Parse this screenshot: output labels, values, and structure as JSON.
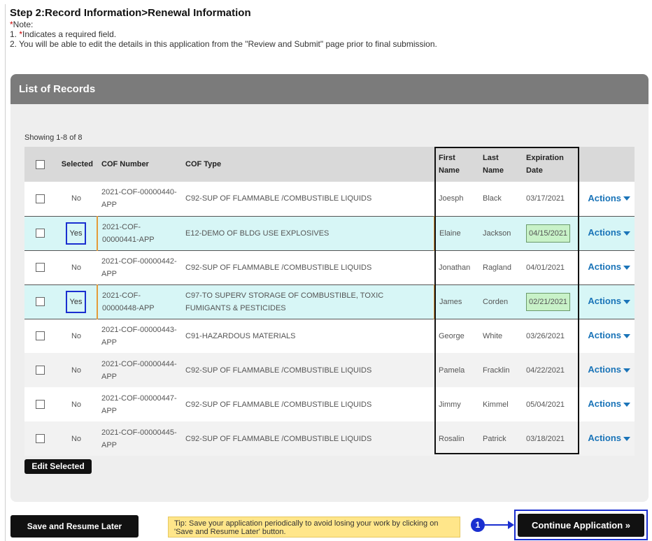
{
  "step_title": "Step 2:Record Information>Renewal Information",
  "notes": {
    "star": "*",
    "note_label": "Note:",
    "line1_prefix": "1. ",
    "line1_star": "*",
    "line1_text": "Indicates a required field.",
    "line2": "2. You will be able to edit the details in this application from the \"Review and Submit\" page prior to final submission."
  },
  "panel_title": "List of Records",
  "showing": "Showing 1-8 of 8",
  "columns": {
    "selected": "Selected",
    "cof_number": "COF Number",
    "cof_type": "COF Type",
    "first_name": "First Name",
    "last_name": "Last Name",
    "expiration": "Expiration Date"
  },
  "rows": [
    {
      "selected": "No",
      "cof": "2021-COF-00000440-APP",
      "type": "C92-SUP OF FLAMMABLE /COMBUSTIBLE LIQUIDS",
      "first": "Joesph",
      "last": "Black",
      "date": "03/17/2021",
      "actions": "Actions"
    },
    {
      "selected": "Yes",
      "cof": "2021-COF-00000441-APP",
      "type": "E12-DEMO OF BLDG USE EXPLOSIVES",
      "first": "Elaine",
      "last": "Jackson",
      "date": "04/15/2021",
      "actions": "Actions"
    },
    {
      "selected": "No",
      "cof": "2021-COF-00000442-APP",
      "type": "C92-SUP OF FLAMMABLE /COMBUSTIBLE LIQUIDS",
      "first": "Jonathan",
      "last": "Ragland",
      "date": "04/01/2021",
      "actions": "Actions"
    },
    {
      "selected": "Yes",
      "cof": "2021-COF-00000448-APP",
      "type": "C97-TO SUPERV STORAGE OF COMBUSTIBLE, TOXIC FUMIGANTS & PESTICIDES",
      "first": "James",
      "last": "Corden",
      "date": "02/21/2021",
      "actions": "Actions"
    },
    {
      "selected": "No",
      "cof": "2021-COF-00000443-APP",
      "type": "C91-HAZARDOUS MATERIALS",
      "first": "George",
      "last": "White",
      "date": "03/26/2021",
      "actions": "Actions"
    },
    {
      "selected": "No",
      "cof": "2021-COF-00000444-APP",
      "type": "C92-SUP OF FLAMMABLE /COMBUSTIBLE LIQUIDS",
      "first": "Pamela",
      "last": "Fracklin",
      "date": "04/22/2021",
      "actions": "Actions"
    },
    {
      "selected": "No",
      "cof": "2021-COF-00000447-APP",
      "type": "C92-SUP OF FLAMMABLE /COMBUSTIBLE LIQUIDS",
      "first": "Jimmy",
      "last": "Kimmel",
      "date": "05/04/2021",
      "actions": "Actions"
    },
    {
      "selected": "No",
      "cof": "2021-COF-00000445-APP",
      "type": "C92-SUP OF FLAMMABLE /COMBUSTIBLE LIQUIDS",
      "first": "Rosalin",
      "last": "Patrick",
      "date": "03/18/2021",
      "actions": "Actions"
    }
  ],
  "edit_selected": "Edit Selected",
  "save_resume": "Save and Resume Later",
  "tip": "Tip: Save your application periodically to avoid losing your work by clicking on 'Save and Resume Later' button.",
  "callout_number": "1",
  "continue_label": "Continue Application »",
  "colors": {
    "selected_row": "#d7f6f6",
    "highlight_blue": "#1a2fd0",
    "highlight_orange": "#e39b3a",
    "date_green": "#c8f2c8",
    "actions_link": "#1a74b8",
    "tip_bg": "#ffe68a"
  }
}
